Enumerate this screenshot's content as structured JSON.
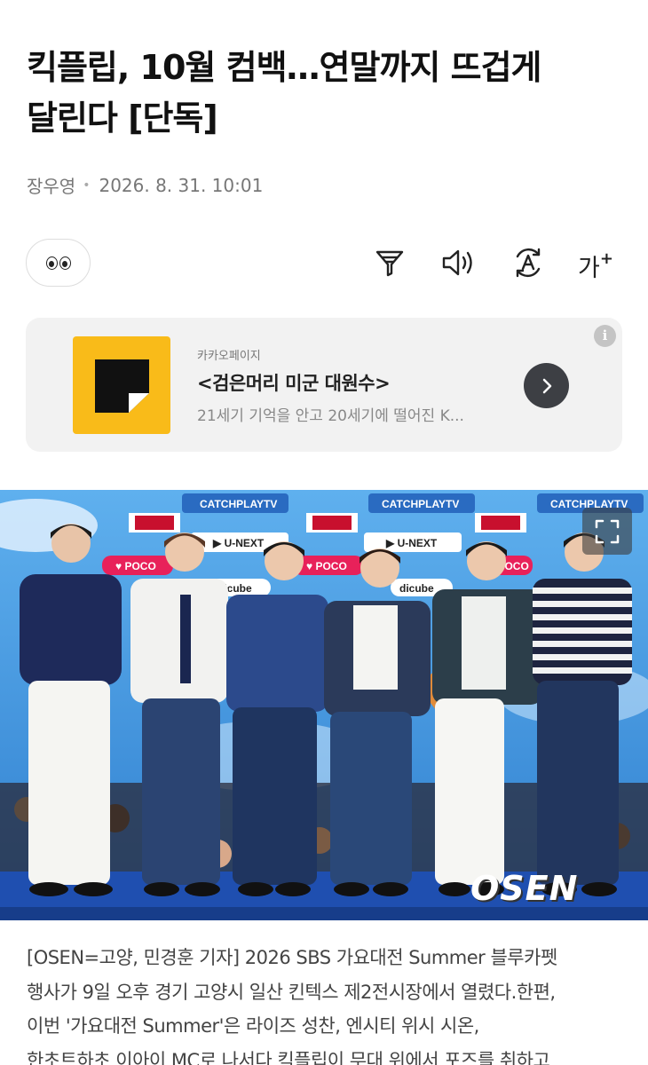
{
  "article": {
    "headline_line1": "킥플립, 10월 컴백…연말까지 뜨겁게",
    "headline_line2": "달린다 [단독]",
    "author": "장우영",
    "date": "2026. 8. 31. 10:01",
    "body_lines": [
      "[OSEN=고양, 민경훈 기자] 2026 SBS 가요대전 Summer 블루카펫",
      "행사가 9일 오후 경기 고양시 일산 킨텍스 제2전시장에서 열렸다.한편,",
      "이번 '가요대전 Summer'은 라이즈 성찬, 엔시티 위시 시온,",
      "한초트하초 이아이 MC로 나서다 킥플립이 무대 위에서 포즈를 취하고"
    ]
  },
  "toolbar": {
    "reaction_icon": "eyes-emoji-icon",
    "icons": [
      "summary-icon",
      "speaker-icon",
      "translate-icon"
    ],
    "font_size_label": "가",
    "font_size_sup": "+"
  },
  "ad": {
    "brand": "카카오페이지",
    "title": "<검은머리 미군 대원수>",
    "description": "21세기 기억을 안고 20세기에 떨어진 K...",
    "info_label": "i"
  },
  "photo": {
    "watermark": "OSEN",
    "backdrop_texts": [
      "CATCHPLAYTV",
      "U-NEXT",
      "POCO",
      "dicube"
    ]
  },
  "colors": {
    "ad_thumb": "#f9bb19",
    "sky": "#3a8fd6",
    "stage": "#1f4fb0"
  }
}
